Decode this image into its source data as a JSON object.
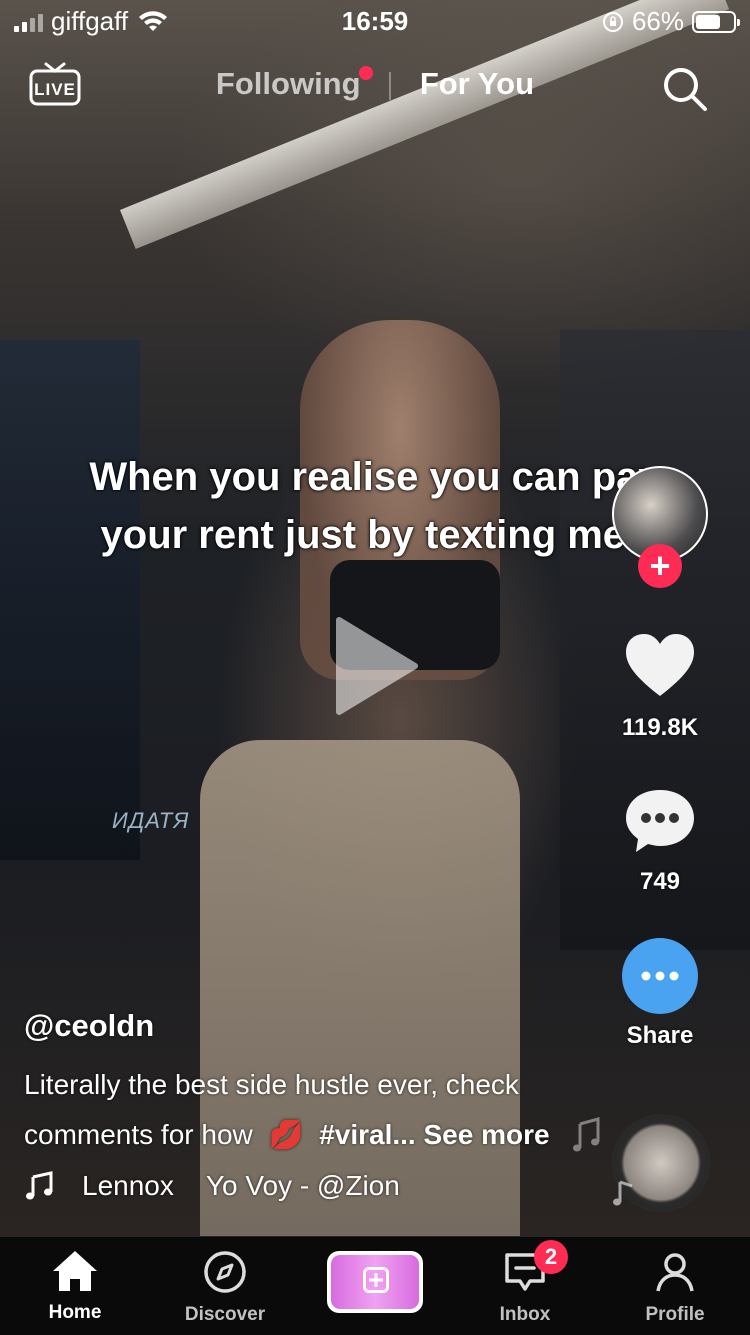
{
  "status_bar": {
    "carrier": "giffgaff",
    "time": "16:59",
    "battery_percent": "66%",
    "battery_level": 0.66
  },
  "top_nav": {
    "live_label": "LIVE",
    "following_label": "Following",
    "for_you_label": "For You",
    "active_tab": "For You"
  },
  "video": {
    "caption": "When you realise you can pay your rent just by texting men",
    "neon_sign": "ИДАТЯ"
  },
  "actions": {
    "like_count": "119.8K",
    "comment_count": "749",
    "share_label": "Share"
  },
  "post": {
    "username": "@ceoldn",
    "description_line1": "Literally the best side hustle ever, check",
    "description_line2_prefix": "comments for how",
    "description_emoji": "💋",
    "hashtag": "#viral...",
    "see_more": "See more",
    "music_artist": "Lennox",
    "music_title": "Yo Voy - @Zion"
  },
  "bottom_nav": {
    "home_label": "Home",
    "discover_label": "Discover",
    "inbox_label": "Inbox",
    "profile_label": "Profile",
    "inbox_badge": "2"
  },
  "colors": {
    "accent_red": "#fe2c55",
    "share_blue": "#4aa3f0",
    "create_pink": "#e88ae8"
  }
}
